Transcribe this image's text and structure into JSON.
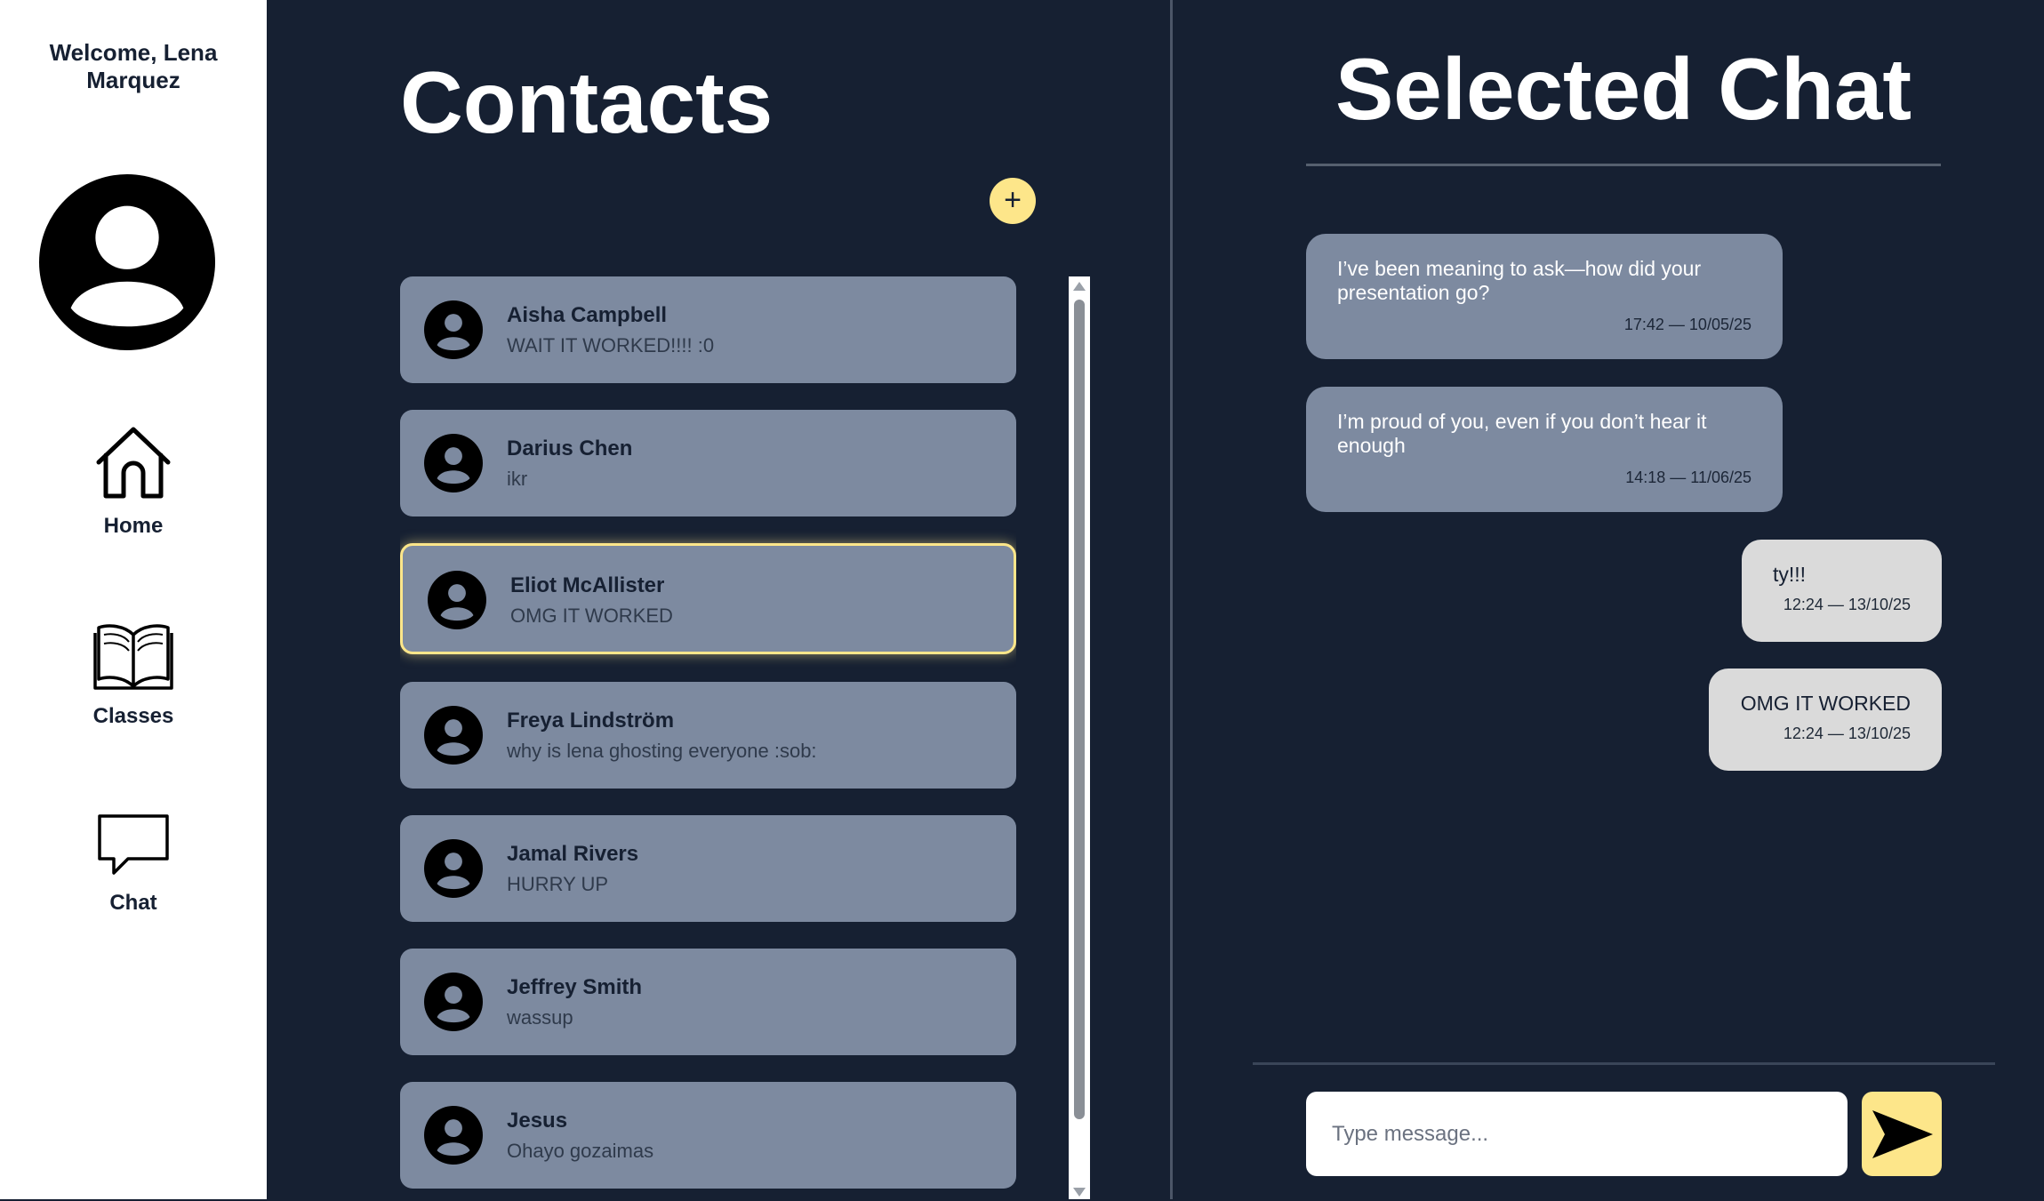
{
  "sidebar": {
    "welcome": "Welcome, Lena Marquez",
    "nav": [
      {
        "label": "Home",
        "icon": "home-icon"
      },
      {
        "label": "Classes",
        "icon": "book-icon"
      },
      {
        "label": "Chat",
        "icon": "chat-bubble-icon"
      }
    ]
  },
  "contacts": {
    "title": "Contacts",
    "add_label": "+",
    "items": [
      {
        "name": "Aisha Campbell",
        "last_message": "WAIT IT WORKED!!!! :0",
        "selected": false
      },
      {
        "name": "Darius Chen",
        "last_message": "ikr",
        "selected": false
      },
      {
        "name": "Eliot McAllister",
        "last_message": "OMG IT WORKED",
        "selected": true
      },
      {
        "name": "Freya Lindström",
        "last_message": "why is lena ghosting everyone :sob:",
        "selected": false
      },
      {
        "name": "Jamal Rivers",
        "last_message": "HURRY UP",
        "selected": false
      },
      {
        "name": "Jeffrey Smith",
        "last_message": "wassup",
        "selected": false
      },
      {
        "name": "Jesus",
        "last_message": "Ohayo gozaimas",
        "selected": false
      }
    ]
  },
  "chat": {
    "title": "Selected Chat",
    "messages": [
      {
        "text": "I’ve been meaning to ask—how did your presentation go?",
        "time": "17:42 — 10/05/25",
        "direction": "received"
      },
      {
        "text": "I’m proud of you, even if you don’t hear it enough",
        "time": "14:18 — 11/06/25",
        "direction": "received"
      },
      {
        "text": "ty!!!",
        "time": "12:24 — 13/10/25",
        "direction": "sent"
      },
      {
        "text": "OMG IT WORKED",
        "time": "12:24 — 13/10/25",
        "direction": "sent"
      }
    ],
    "input_placeholder": "Type message...",
    "input_value": "",
    "send_icon": "send-icon"
  },
  "colors": {
    "background": "#162032",
    "card": "#7d8aa0",
    "accent": "#fde68a",
    "sent_bubble": "#dadada",
    "sidebar": "#ffffff"
  }
}
